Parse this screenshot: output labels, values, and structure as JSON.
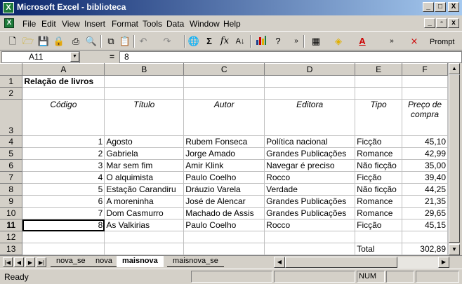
{
  "window": {
    "title": "Microsoft Excel - biblioteca",
    "app_icon": "excel-icon",
    "controls": {
      "minimize": "_",
      "maximize": "□",
      "close": "X"
    }
  },
  "menu": {
    "items": [
      "File",
      "Edit",
      "View",
      "Insert",
      "Format",
      "Tools",
      "Data",
      "Window",
      "Help"
    ],
    "doc_controls": {
      "minimize": "_",
      "restore": "▫",
      "close": "x"
    }
  },
  "toolbar": {
    "prompt_label": "Prompt",
    "icons": [
      "new-icon",
      "open-icon",
      "save-icon",
      "permission-icon",
      "print-icon",
      "print-preview-icon",
      "copy-icon",
      "paste-icon",
      "undo-icon",
      "redo-icon",
      "hyperlink-icon",
      "autosum-icon",
      "function-icon",
      "sort-ascending-icon",
      "chart-icon",
      "help-icon",
      "borders-icon",
      "fill-color-icon",
      "font-color-icon",
      "pdf-icon"
    ]
  },
  "formula_bar": {
    "name_box": "A11",
    "equals": "=",
    "value": "8"
  },
  "grid": {
    "columns": [
      "A",
      "B",
      "C",
      "D",
      "E",
      "F"
    ],
    "rows": [
      "1",
      "2",
      "3",
      "4",
      "5",
      "6",
      "7",
      "8",
      "9",
      "10",
      "11",
      "12",
      "13"
    ],
    "active_row": "11",
    "title": "Relação de livros",
    "headers": {
      "codigo": "Código",
      "titulo": "Título",
      "autor": "Autor",
      "editora": "Editora",
      "tipo": "Tipo",
      "preco": "Preço de compra"
    },
    "books": [
      {
        "codigo": "1",
        "titulo": "Agosto",
        "autor": "Rubem Fonseca",
        "editora": "Política nacional",
        "tipo": "Ficção",
        "preco": "45,10"
      },
      {
        "codigo": "2",
        "titulo": "Gabriela",
        "autor": "Jorge Amado",
        "editora": "Grandes Publicações",
        "tipo": "Romance",
        "preco": "42,99"
      },
      {
        "codigo": "3",
        "titulo": "Mar sem fim",
        "autor": "Amir Klink",
        "editora": "Navegar é preciso",
        "tipo": "Não ficção",
        "preco": "35,00"
      },
      {
        "codigo": "4",
        "titulo": "O alquimista",
        "autor": "Paulo Coelho",
        "editora": "Rocco",
        "tipo": "Ficção",
        "preco": "39,40"
      },
      {
        "codigo": "5",
        "titulo": "Estação Carandiru",
        "autor": "Dráuzio Varela",
        "editora": "Verdade",
        "tipo": "Não ficção",
        "preco": "44,25"
      },
      {
        "codigo": "6",
        "titulo": "A moreninha",
        "autor": "José de Alencar",
        "editora": "Grandes Publicações",
        "tipo": "Romance",
        "preco": "21,35"
      },
      {
        "codigo": "7",
        "titulo": "Dom Casmurro",
        "autor": "Machado de Assis",
        "editora": "Grandes Publicações",
        "tipo": "Romance",
        "preco": "29,65"
      },
      {
        "codigo": "8",
        "titulo": "As Valkirias",
        "autor": "Paulo Coelho",
        "editora": "Rocco",
        "tipo": "Ficção",
        "preco": "45,15"
      }
    ],
    "total_label": "Total",
    "total_value": "302,89"
  },
  "sheets": {
    "tabs": [
      "nova_se",
      "nova",
      "maisnova",
      "maisnova_se"
    ],
    "active": "maisnova"
  },
  "status": {
    "mode": "Ready",
    "num": "NUM"
  }
}
